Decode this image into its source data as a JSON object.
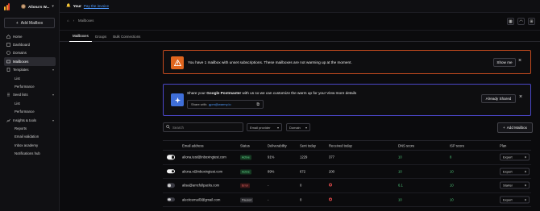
{
  "account": {
    "name": "Aliona's W..."
  },
  "sidebar": {
    "add_mailbox": "Add Mailbox",
    "items": [
      {
        "label": "Home",
        "icon": "home-icon"
      },
      {
        "label": "Dashboard",
        "icon": "dashboard-icon"
      },
      {
        "label": "Domains",
        "icon": "globe-icon"
      },
      {
        "label": "Mailboxes",
        "icon": "mailbox-icon"
      },
      {
        "label": "Templates",
        "icon": "template-icon"
      },
      {
        "label": "List"
      },
      {
        "label": "Performance"
      },
      {
        "label": "Seed lists",
        "icon": "seed-icon"
      },
      {
        "label": "List"
      },
      {
        "label": "Performance"
      },
      {
        "label": "Insights & tools",
        "icon": "insights-icon"
      },
      {
        "label": "Reports"
      },
      {
        "label": "Email validation"
      },
      {
        "label": "Inbox academy"
      },
      {
        "label": "Notifications hub"
      }
    ]
  },
  "topbar": {
    "prefix": "Your",
    "link": "Pay the invoice"
  },
  "breadcrumb": {
    "current": "Mailboxes"
  },
  "tabs": [
    "Mailboxes",
    "Groups",
    "Bulk Connections"
  ],
  "alert_subscription": {
    "text": "You have 1 mailbox with unset subscriptions. These mailboxes are not warming up at the moment.",
    "button": "Show me"
  },
  "alert_postmaster": {
    "text_prefix": "Share your ",
    "text_bold": "Google Postmaster",
    "text_suffix": " with us so we can customize the warm up for you! View more details",
    "share_label": "Share with:",
    "share_email": "gpm@warmy.io",
    "button": "Already Shared"
  },
  "toolbar": {
    "search_placeholder": "Search",
    "email_provider": "Email provider",
    "domain": "Domain",
    "add_mailbox": "Add Mailbox"
  },
  "table": {
    "headers": [
      "Email address",
      "Status",
      "Deliverability",
      "Sent today",
      "Received today",
      "DNS score",
      "ISP score",
      "Plan"
    ],
    "rows": [
      {
        "enabled": true,
        "email": "aliona.test@inboxingtest.com",
        "status": "Active",
        "deliverability": "91%",
        "sent": "1229",
        "received": "377",
        "dns": "10",
        "isp": "8",
        "plan": "Expert"
      },
      {
        "enabled": true,
        "email": "aliona.v@inboxingtest.com",
        "status": "Active",
        "deliverability": "89%",
        "sent": "672",
        "received": "200",
        "dns": "10",
        "isp": "10",
        "plan": "Expert"
      },
      {
        "enabled": false,
        "email": "alisa@amcfullpacks.com",
        "status": "Error",
        "deliverability": "-",
        "sent": "0",
        "received": "",
        "dns": "6.1",
        "isp": "10",
        "plan": "Starter"
      },
      {
        "enabled": false,
        "email": "aleciicemail3@gmail.com",
        "status": "Paused",
        "deliverability": "-",
        "sent": "0",
        "received": "",
        "dns": "10",
        "isp": "10",
        "plan": "Expert"
      }
    ]
  },
  "colors": {
    "accent": "#4f9bff",
    "warning": "#e0661f",
    "postmaster": "#4b47c8",
    "active": "#5fd38a",
    "error": "#ef6a6a"
  }
}
